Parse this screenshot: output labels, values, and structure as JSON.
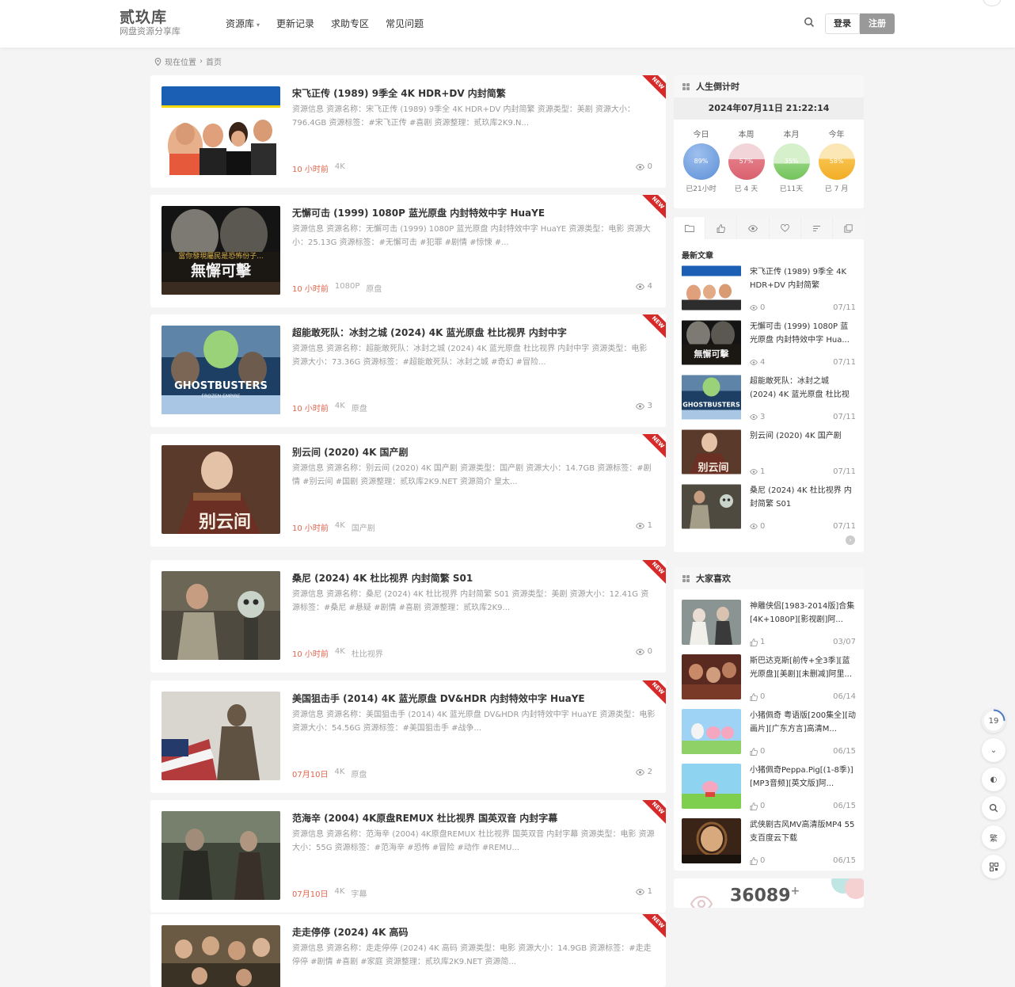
{
  "header": {
    "logo_main": "贰玖库",
    "logo_sub": "网盘资源分享库",
    "nav": [
      "资源库",
      "更新记录",
      "求助专区",
      "常见问题"
    ],
    "login": "登录",
    "register": "注册"
  },
  "breadcrumb": {
    "location": "现在位置",
    "home": "首页"
  },
  "posts": [
    {
      "title": "宋飞正传 (1989) 9季全 4K HDR+DV 内封简繁",
      "desc": "资源信息 资源名称：宋飞正传 (1989) 9季全 4K HDR+DV 内封简繁 资源类型：美剧 资源大小：796.4GB 资源标签：#宋飞正传 #喜剧 资源整理：贰玖库2K9.N...",
      "time": "10 小时前",
      "tags": [
        "4K"
      ],
      "views": "0",
      "ribbon": "NEW"
    },
    {
      "title": "无懈可击 (1999) 1080P 蓝光原盘 内封特效中字 HuaYE",
      "desc": "资源信息 资源名称：无懈可击 (1999) 1080P 蓝光原盘 内封特效中字 HuaYE 资源类型：电影 资源大小：25.13G 资源标签：#无懈可击 #犯罪 #剧情 #惊悚 #...",
      "time": "10 小时前",
      "tags": [
        "1080P",
        "原盘"
      ],
      "views": "4",
      "ribbon": "NEW",
      "poster_text": "無懈可擊"
    },
    {
      "title": "超能敢死队：冰封之城 (2024) 4K 蓝光原盘 杜比视界 内封中字",
      "desc": "资源信息 资源名称：超能敢死队：冰封之城 (2024) 4K 蓝光原盘 杜比视界 内封中字 资源类型：电影 资源大小：73.36G 资源标签：#超能敢死队：冰封之城 #奇幻 #冒险...",
      "time": "10 小时前",
      "tags": [
        "4K",
        "原盘"
      ],
      "views": "3",
      "ribbon": "NEW",
      "poster_text": "GHOSTBUSTERS"
    },
    {
      "title": "别云间 (2020) 4K 国产剧",
      "desc": "资源信息 资源名称：别云间 (2020) 4K 国产剧 资源类型：国产剧 资源大小：14.7GB 资源标签：#剧情 #别云间 #国剧 资源整理：贰玖库2K9.NET 资源简介 皇太...",
      "time": "10 小时前",
      "tags": [
        "4K",
        "国产剧"
      ],
      "views": "1",
      "ribbon": "NEW",
      "poster_text": "别云间"
    },
    {
      "title": "桑尼 (2024) 4K 杜比视界 内封简繁 S01",
      "desc": "资源信息 资源名称：桑尼 (2024) 4K 杜比视界 内封简繁 S01 资源类型：美剧 资源大小：12.41G 资源标签：#桑尼 #悬疑 #剧情 #喜剧 资源整理：贰玖库2K9...",
      "time": "10 小时前",
      "tags": [
        "4K",
        "杜比视界"
      ],
      "views": "0",
      "ribbon": "NEW"
    },
    {
      "title": "美国狙击手 (2014) 4K 蓝光原盘 DV&HDR 内封特效中字 HuaYE",
      "desc": "资源信息 资源名称：美国狙击手 (2014) 4K 蓝光原盘 DV&HDR 内封特效中字 HuaYE 资源类型：电影 资源大小：54.56G 资源标签：#美国狙击手 #战争...",
      "time": "07月10日",
      "tags": [
        "4K",
        "原盘"
      ],
      "views": "2",
      "ribbon": "NEW"
    },
    {
      "title": "范海辛 (2004) 4K原盘REMUX 杜比视界 国英双音 内封字幕",
      "desc": "资源信息 资源名称：范海辛 (2004) 4K原盘REMUX 杜比视界 国英双音 内封字幕 资源类型：电影 资源大小：55G 资源标签：#范海辛 #恐怖 #冒险 #动作 #REMU...",
      "time": "07月10日",
      "tags": [
        "4K",
        "字幕"
      ],
      "views": "1",
      "ribbon": "NEW"
    },
    {
      "title": "走走停停 (2024) 4K 高码",
      "desc": "资源信息 资源名称：走走停停 (2024) 4K 高码 资源类型：电影 资源大小：14.9GB 资源标签：#走走停停 #剧情 #喜剧 #家庭 资源整理：贰玖库2K9.NET 资源简...",
      "time": "",
      "tags": [],
      "views": "",
      "ribbon": "NEW"
    }
  ],
  "countdown": {
    "title": "人生倒计时",
    "datetime": "2024年07月11日 21:22:14",
    "items": [
      {
        "label": "今日",
        "pct": "89%",
        "sub": "已21小时",
        "color": "#5b8fd6"
      },
      {
        "label": "本周",
        "pct": "57%",
        "sub": "已 4 天",
        "color": "#e37b86"
      },
      {
        "label": "本月",
        "pct": "35%",
        "sub": "已11天",
        "color": "#8fd27a"
      },
      {
        "label": "今年",
        "pct": "58%",
        "sub": "已 7 月",
        "color": "#f7c24c"
      }
    ]
  },
  "latest": {
    "heading": "最新文章",
    "items": [
      {
        "title": "宋飞正传 (1989) 9季全 4K HDR+DV 内封简繁",
        "views": "0",
        "date": "07/11"
      },
      {
        "title": "无懈可击 (1999) 1080P 蓝光原盘 内封特效中字 Hua...",
        "views": "4",
        "date": "07/11"
      },
      {
        "title": "超能敢死队：冰封之城 (2024) 4K 蓝光原盘 杜比视界 ...",
        "views": "3",
        "date": "07/11"
      },
      {
        "title": "别云间 (2020) 4K 国产剧",
        "views": "1",
        "date": "07/11"
      },
      {
        "title": "桑尼 (2024) 4K 杜比视界 内封简繁 S01",
        "views": "0",
        "date": "07/11"
      }
    ]
  },
  "popular": {
    "title": "大家喜欢",
    "items": [
      {
        "title": "神雕侠侣[1983-2014版]合集[4K+1080P][影视剧]阿...",
        "likes": "1",
        "date": "03/07"
      },
      {
        "title": "斯巴达克斯[前传+全3季][蓝光原盘][美剧][未删减]阿里...",
        "likes": "0",
        "date": "06/14"
      },
      {
        "title": "小猪佩奇 粤语版[200集全][动画片][广东方言]高清M...",
        "likes": "0",
        "date": "06/15"
      },
      {
        "title": "小猪佩奇Peppa.Pig[(1-8季)][MP3音频][英文版]阿...",
        "likes": "0",
        "date": "06/15"
      },
      {
        "title": "武侠剧古风MV高清版MP4 55支百度云下载",
        "likes": "0",
        "date": "06/15"
      }
    ]
  },
  "stats": {
    "count": "36089",
    "plus": "+"
  },
  "float": {
    "progress": "19",
    "lang": "繁"
  }
}
